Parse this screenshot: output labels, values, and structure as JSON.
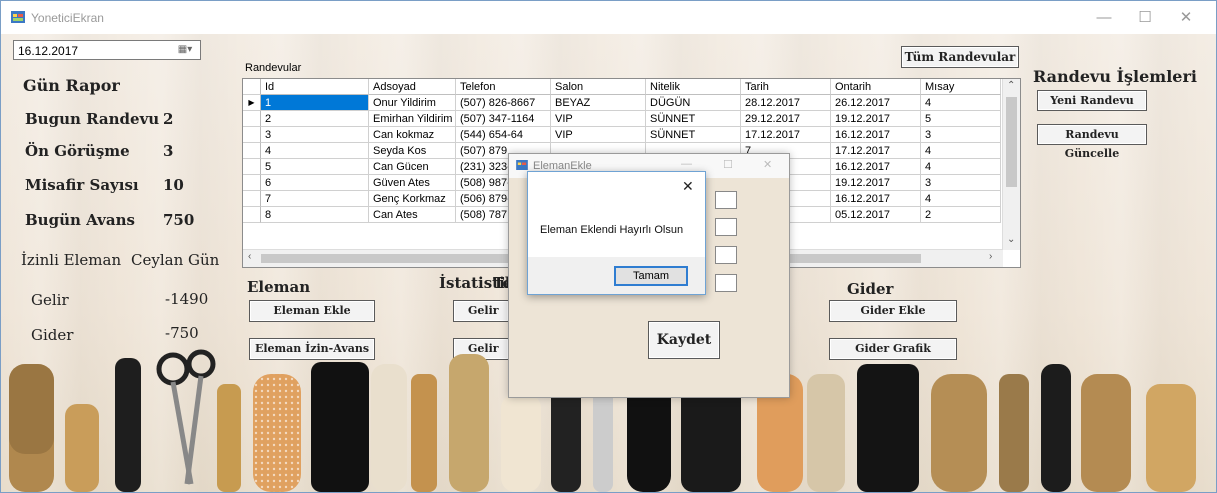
{
  "window": {
    "title": "YoneticiEkran",
    "controls": {
      "minimize": "—",
      "maximize": "☐",
      "close": "✕"
    }
  },
  "date_picker": {
    "value": "16.12.2017"
  },
  "report": {
    "heading": "Gün Rapor",
    "rows": [
      {
        "label": "Bugun Randevu",
        "value": "2"
      },
      {
        "label": "Ön Görüşme",
        "value": "3"
      },
      {
        "label": "Misafir Sayısı",
        "value": "10"
      },
      {
        "label": "Bugün Avans",
        "value": "750"
      }
    ],
    "izinli_label": "İzinli Eleman",
    "izinli_value": "Ceylan Gün",
    "gelir_label": "Gelir",
    "gelir_value": "-1490",
    "gider_label": "Gider",
    "gider_value": "-750"
  },
  "grid": {
    "label": "Randevular",
    "columns": [
      "Id",
      "Adsoyad",
      "Telefon",
      "Salon",
      "Nitelik",
      "Tarih",
      "Ontarih",
      "Mısay"
    ],
    "rows": [
      [
        "1",
        "Onur Yildirim",
        "(507) 826-8667",
        "BEYAZ",
        "DÜGÜN",
        "28.12.2017",
        "26.12.2017",
        "4"
      ],
      [
        "2",
        "Emirhan Yildirim",
        "(507) 347-1164",
        "VIP",
        "SÜNNET",
        "29.12.2017",
        "19.12.2017",
        "5"
      ],
      [
        "3",
        "Can kokmaz",
        "(544) 654-64",
        "VIP",
        "SÜNNET",
        "17.12.2017",
        "16.12.2017",
        "3"
      ],
      [
        "4",
        "Seyda Kos",
        "(507) 879",
        "",
        "",
        "7",
        "17.12.2017",
        "4"
      ],
      [
        "5",
        "Can Gücen",
        "(231) 323-",
        "",
        "",
        "7",
        "16.12.2017",
        "4"
      ],
      [
        "6",
        "Güven Ates",
        "(508) 987-",
        "",
        "",
        "7",
        "19.12.2017",
        "3"
      ],
      [
        "7",
        "Genç Korkmaz",
        "(506) 879-",
        "",
        "",
        "7",
        "16.12.2017",
        "4"
      ],
      [
        "8",
        "Can Ates",
        "(508) 787",
        "",
        "",
        "7",
        "05.12.2017",
        "2"
      ]
    ]
  },
  "buttons": {
    "tum_randevular": "Tüm Randevular",
    "yeni_randevu": "Yeni Randevu",
    "randevu_guncelle": "Randevu Güncelle",
    "eleman_ekle": "Eleman Ekle",
    "eleman_izin": "Eleman İzin-Avans",
    "gelir_1": "Gelir E",
    "gelir_2": "Gelir G",
    "gider_ekle": "Gider Ekle",
    "gider_grafik": "Gider Grafik"
  },
  "sections": {
    "randevu_islemleri": "Randevu İşlemleri",
    "eleman": "Eleman",
    "istatistik": "İstatistik",
    "istatistik_tail": "Te",
    "gider": "Gider"
  },
  "eleman_dialog": {
    "title": "ElemanEkle",
    "kaydet": "Kaydet"
  },
  "message_box": {
    "text": "Eleman Eklendi Hayırlı Olsun",
    "ok": "Tamam",
    "close": "✕"
  },
  "colors": {
    "selection": "#0078d7",
    "background": "#efe6da",
    "accent_border": "#2f7dd1"
  }
}
